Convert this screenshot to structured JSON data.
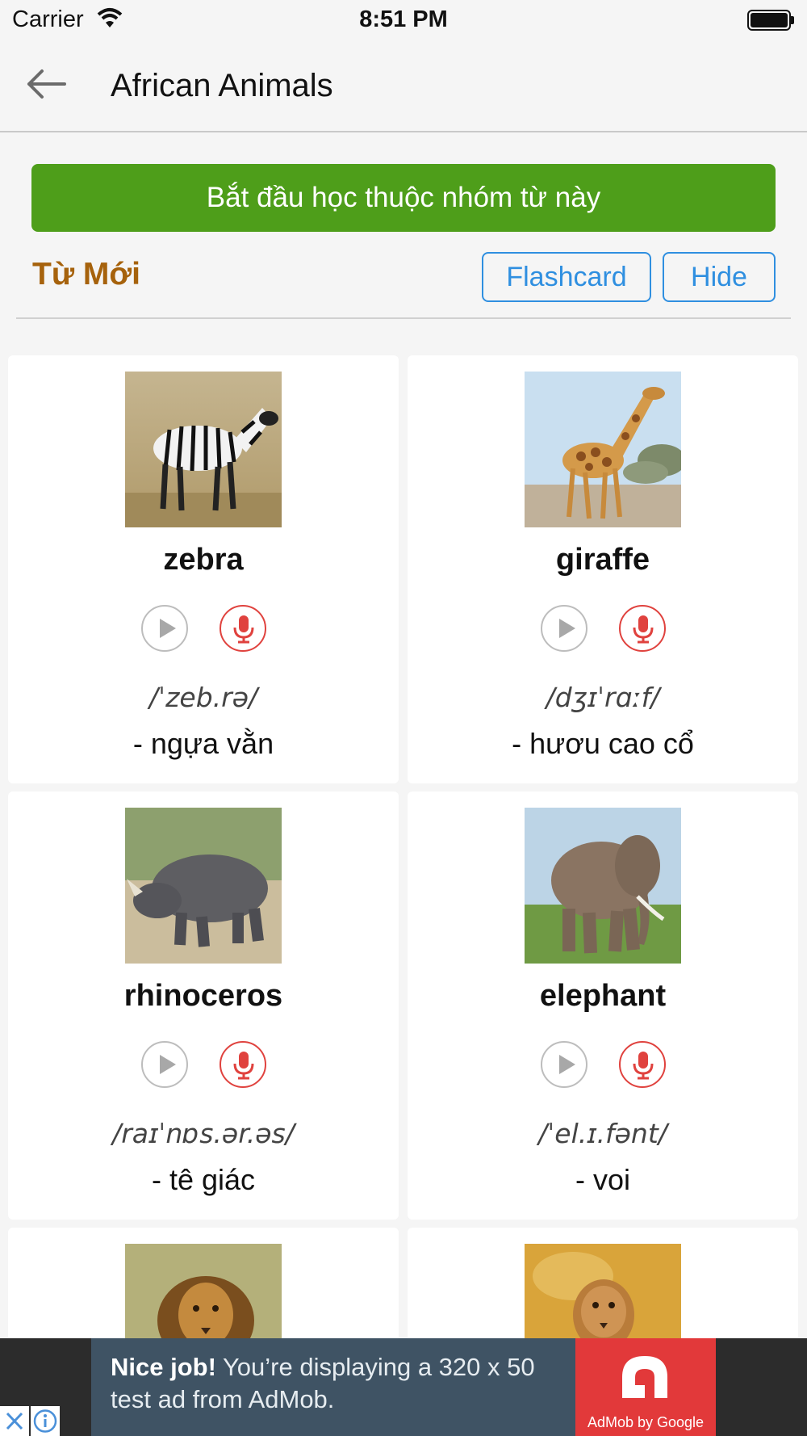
{
  "status_bar": {
    "carrier": "Carrier",
    "time": "8:51 PM"
  },
  "nav": {
    "title": "African Animals",
    "back_icon": "back-arrow-icon"
  },
  "start_button": {
    "label": "Bắt đầu học thuộc nhóm từ này",
    "color": "#4e9e1a"
  },
  "section": {
    "title": "Từ Mới",
    "flashcard_label": "Flashcard",
    "hide_label": "Hide",
    "accent": "#a6620c",
    "button_color": "#2f8fe0"
  },
  "cards": [
    {
      "word": "zebra",
      "ipa": "/ˈzeb.rə/",
      "meaning": "- ngựa vằn",
      "image": "zebra"
    },
    {
      "word": "giraffe",
      "ipa": "/dʒɪˈrɑːf/",
      "meaning": "- hươu cao cổ",
      "image": "giraffe"
    },
    {
      "word": "rhinoceros",
      "ipa": "/raɪˈnɒs.ər.əs/",
      "meaning": "- tê giác",
      "image": "rhinoceros"
    },
    {
      "word": "elephant",
      "ipa": "/ˈel.ɪ.fənt/",
      "meaning": "- voi",
      "image": "elephant"
    },
    {
      "word": "",
      "ipa": "",
      "meaning": "",
      "image": "lion"
    },
    {
      "word": "",
      "ipa": "",
      "meaning": "",
      "image": "lioness"
    }
  ],
  "ad": {
    "headline": "Nice job!",
    "body": " You’re displaying a 320 x 50 test ad from AdMob.",
    "brand": "AdMob by Google",
    "background": "#3f5364",
    "logo_color": "#e2393a"
  }
}
